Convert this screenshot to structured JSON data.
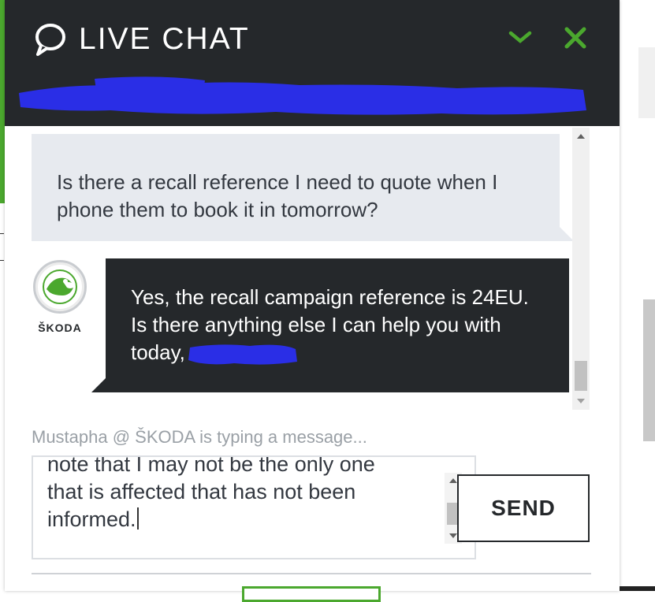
{
  "header": {
    "title": "LIVE CHAT",
    "chat_icon": "speech-bubble-icon",
    "minimize_icon": "chevron-down-icon",
    "close_icon": "close-icon"
  },
  "messages": [
    {
      "sender": "user",
      "text": "Is there a recall reference I need to quote when I phone them to book it in tomorrow?"
    },
    {
      "sender": "agent",
      "avatar_brand": "ŠKODA",
      "text": "Yes, the recall campaign reference is 24EU. Is there anything else I can help you with today,"
    }
  ],
  "typing_indicator": "Mustapha @ ŠKODA is typing a message...",
  "input": {
    "value": "note that I may not be the only one\nthat is affected that has not been\ninformed."
  },
  "send_button": "SEND",
  "colors": {
    "header_bg": "#25282b",
    "accent_green": "#4ba82e",
    "user_bubble_bg": "#e7eaef",
    "agent_bubble_bg": "#25282b",
    "redaction": "#2a2ee6"
  }
}
